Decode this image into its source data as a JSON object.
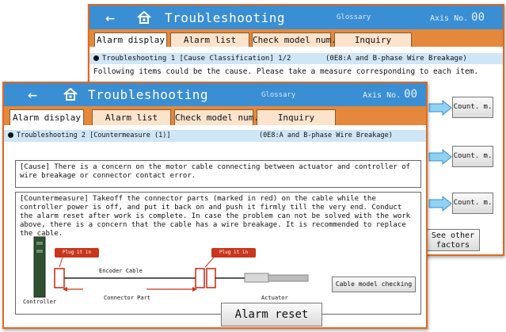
{
  "back_screen": {
    "title": "Troubleshooting",
    "glossary": "Glossary",
    "axis_label": "Axis No.",
    "axis_value": "00",
    "tabs": [
      "Alarm display",
      "Alarm list",
      "Check model num.",
      "Inquiry"
    ],
    "section_title": "Troubleshooting 1 [Cause Classification] 1/2",
    "section_code": "(0E8:A and B-phase Wire Breakage)",
    "intro_text": "Following items could be the cause. Please take a measure corresponding to each item.",
    "count_buttons": [
      "Count. m.",
      "Count. m.",
      "Count. m."
    ],
    "see_other": "See other factors"
  },
  "front_screen": {
    "title": "Troubleshooting",
    "glossary": "Glossary",
    "axis_label": "Axis No.",
    "axis_value": "00",
    "tabs": [
      "Alarm display",
      "Alarm list",
      "Check model num.",
      "Inquiry"
    ],
    "section_title": "Troubleshooting 2 [Countermeasure (1)]",
    "section_code": "(0E8:A and B-phase Wire Breakage)",
    "cause_text": "[Cause] There is a concern on the motor cable connecting between actuator and controller of wire breakage or connector contact error.",
    "countermeasure_text": "[Countermeasure] Takeoff the connector parts (marked in red) on the cable while the controller power is off, and put it back on and push it firmly till the very end. Conduct the alarm reset after work is complete. In case the problem can not be solved with the work above, there is a concern that the cable has a wire breakage. It is recommended to replace the cable.",
    "diagram": {
      "plug_label_1": "Plug it in again.",
      "plug_label_2": "Plug it in again.",
      "encoder_cable": "Encoder Cable",
      "controller": "Controller",
      "connector_part": "Connector Part",
      "actuator": "Actuator"
    },
    "cable_model_button": "Cable model checking",
    "alarm_reset_button": "Alarm reset"
  },
  "colors": {
    "titlebar": "#3a8ed3",
    "frame": "#e1691f",
    "tabstrip": "#e4883b",
    "section": "#cfe6f7",
    "red": "#c8361e"
  }
}
